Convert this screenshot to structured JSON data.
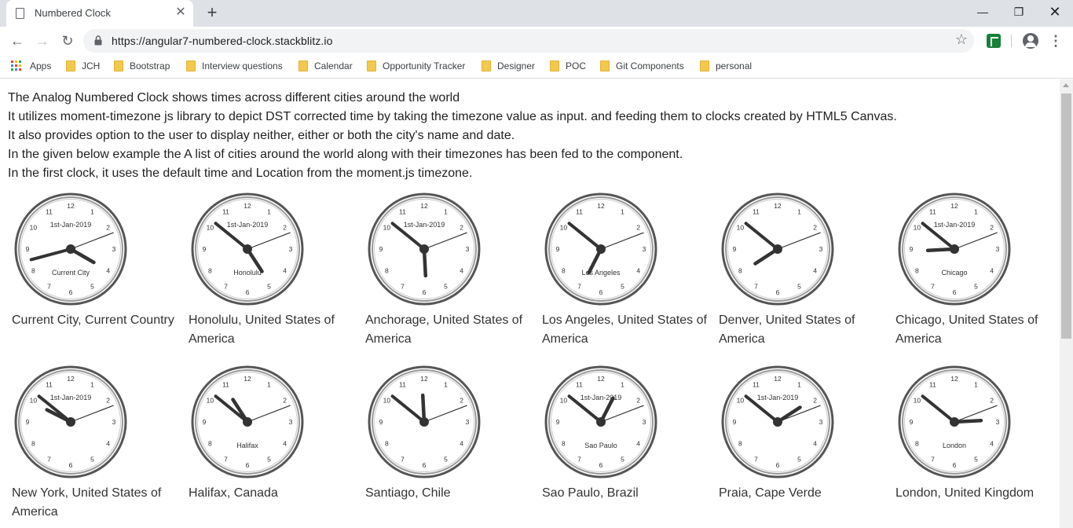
{
  "browser": {
    "tab_title": "Numbered Clock",
    "tab_close": "✕",
    "new_tab": "+",
    "url": "https://angular7-numbered-clock.stackblitz.io",
    "window_controls": {
      "minimize": "—",
      "maximize": "❐",
      "close": "✕"
    },
    "toolbar_icons": {
      "back": "←",
      "forward": "→",
      "reload": "↻",
      "star": "☆",
      "menu": "⋮"
    }
  },
  "bookmarks": [
    {
      "label": "Apps",
      "icon": "apps-grid-icon"
    },
    {
      "label": "JCH",
      "icon": "folder-icon"
    },
    {
      "label": "Bootstrap",
      "icon": "folder-icon"
    },
    {
      "label": "Interview questions",
      "icon": "folder-icon"
    },
    {
      "label": "Calendar",
      "icon": "folder-icon"
    },
    {
      "label": "Opportunity Tracker",
      "icon": "folder-icon"
    },
    {
      "label": "Designer",
      "icon": "folder-icon"
    },
    {
      "label": "POC",
      "icon": "folder-icon"
    },
    {
      "label": "Git Components",
      "icon": "folder-icon"
    },
    {
      "label": "personal",
      "icon": "folder-icon"
    }
  ],
  "intro": [
    "The Analog Numbered Clock shows times across different cities around the world",
    "It utilizes moment-timezone js library to depict DST corrected time by taking the timezone value as input. and feeding them to clocks created by HTML5 Canvas.",
    "It also provides option to the user to display neither, either or both the city's name and date.",
    "In the given below example the A list of cities around the world along with their timezones has been fed to the component.",
    "In the first clock, it uses the default time and Location from the moment.js timezone."
  ],
  "clock_numbers": [
    "12",
    "1",
    "2",
    "3",
    "4",
    "5",
    "6",
    "7",
    "8",
    "9",
    "10",
    "11"
  ],
  "clocks": [
    {
      "caption": "Current City, Current Country",
      "date": "1st-Jan-2019",
      "city": "Current City",
      "hour": 4.0,
      "minute": 42.5,
      "second": 11.5
    },
    {
      "caption": "Honolulu, United States of America",
      "date": "1st-Jan-2019",
      "city": "Honolulu",
      "hour": 4.9,
      "minute": 51.5,
      "second": 11.5
    },
    {
      "caption": "Anchorage, United States of America",
      "date": "1st-Jan-2019",
      "city": "",
      "hour": 5.9,
      "minute": 51.5,
      "second": 11.5
    },
    {
      "caption": "Los Angeles, United States of America",
      "date": "",
      "city": "Los Angeles",
      "hour": 6.9,
      "minute": 51.5,
      "second": 11.5
    },
    {
      "caption": "Denver, United States of America",
      "date": "",
      "city": "",
      "hour": 7.9,
      "minute": 51.5,
      "second": 11.5
    },
    {
      "caption": "Chicago, United States of America",
      "date": "1st-Jan-2019",
      "city": "Chicago",
      "hour": 8.9,
      "minute": 51.5,
      "second": 11.5
    },
    {
      "caption": "New York, United States of America",
      "date": "1st-Jan-2019",
      "city": "",
      "hour": 9.9,
      "minute": 51.5,
      "second": 11.5
    },
    {
      "caption": "Halifax, Canada",
      "date": "",
      "city": "Halifax",
      "hour": 10.9,
      "minute": 51.5,
      "second": 11.5
    },
    {
      "caption": "Santiago, Chile",
      "date": "",
      "city": "",
      "hour": 11.9,
      "minute": 51.5,
      "second": 11.5
    },
    {
      "caption": "Sao Paulo, Brazil",
      "date": "1st-Jan-2019",
      "city": "Sao Paulo",
      "hour": 0.9,
      "minute": 51.5,
      "second": 11.5
    },
    {
      "caption": "Praia, Cape Verde",
      "date": "1st-Jan-2019",
      "city": "",
      "hour": 1.9,
      "minute": 51.5,
      "second": 11.5
    },
    {
      "caption": "London, United Kingdom",
      "date": "",
      "city": "London",
      "hour": 2.9,
      "minute": 51.5,
      "second": 11.5
    }
  ],
  "colors": {
    "tabstrip": "#dee1e6",
    "hand": "#333333",
    "rim": "#555555"
  }
}
